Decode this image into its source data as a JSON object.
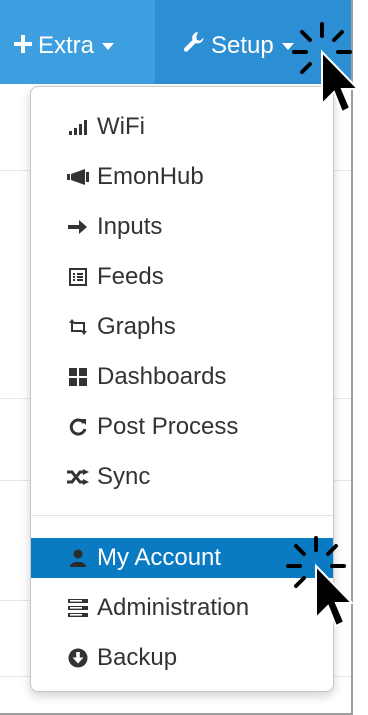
{
  "navbar": {
    "extra_label": "Extra",
    "setup_label": "Setup"
  },
  "dropdown": {
    "items": [
      {
        "label": "WiFi",
        "icon": "signal-icon"
      },
      {
        "label": "EmonHub",
        "icon": "bullhorn-icon"
      },
      {
        "label": "Inputs",
        "icon": "arrow-right-icon"
      },
      {
        "label": "Feeds",
        "icon": "list-alt-icon"
      },
      {
        "label": "Graphs",
        "icon": "retweet-icon"
      },
      {
        "label": "Dashboards",
        "icon": "th-large-icon"
      },
      {
        "label": "Post Process",
        "icon": "refresh-icon"
      },
      {
        "label": "Sync",
        "icon": "random-icon"
      }
    ],
    "account_items": [
      {
        "label": "My Account",
        "icon": "user-icon",
        "active": true
      },
      {
        "label": "Administration",
        "icon": "server-icon"
      },
      {
        "label": "Backup",
        "icon": "download-icon"
      }
    ]
  },
  "colors": {
    "navbar": "#3d9fe0",
    "navbar_active": "#2d8fd3",
    "menu_active": "#0a7bc2"
  }
}
